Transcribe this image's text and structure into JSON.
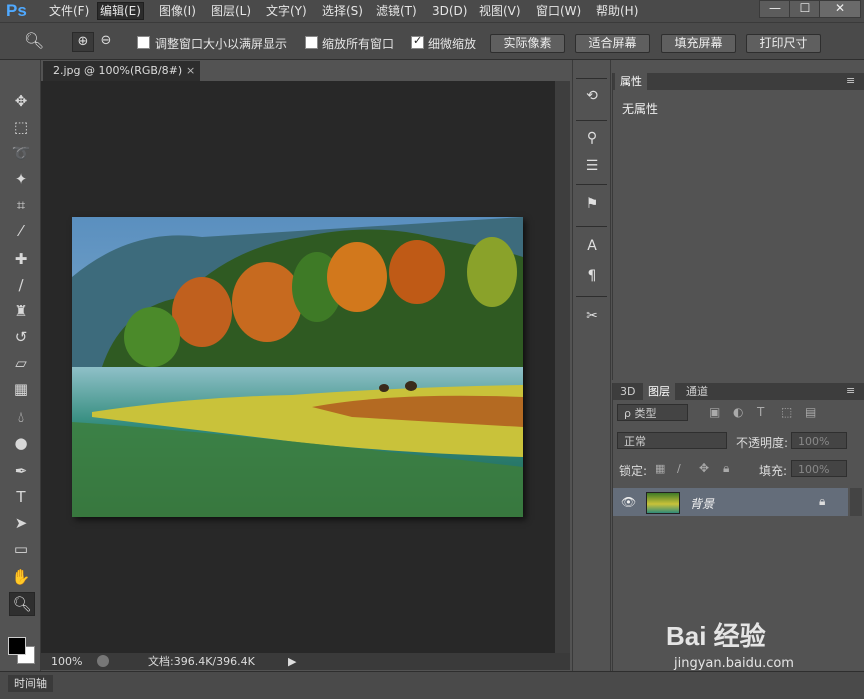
{
  "app": {
    "logo": "Ps"
  },
  "menu": [
    "文件(F)",
    "编辑(E)",
    "图像(I)",
    "图层(L)",
    "文字(Y)",
    "选择(S)",
    "滤镜(T)",
    "3D(D)",
    "视图(V)",
    "窗口(W)",
    "帮助(H)"
  ],
  "active_menu": "编辑(E)",
  "window_controls": {
    "minimize": "—",
    "maximize": "☐",
    "close": "✕"
  },
  "options": {
    "resize_windows": "调整窗口大小以满屏显示",
    "zoom_all": "缩放所有窗口",
    "scrubby_zoom": "细微缩放",
    "actual_pixels": "实际像素",
    "fit_screen": "适合屏幕",
    "fill_screen": "填充屏幕",
    "print_size": "打印尺寸",
    "scrubby_checked": true
  },
  "document": {
    "tab_title": "2.jpg @ 100%(RGB/8#)",
    "tab_close": "×",
    "zoom": "100%",
    "doc_size": "文档:396.4K/396.4K"
  },
  "panels": {
    "properties_tab": "属性",
    "properties_empty": "无属性",
    "layer_tabs": [
      "3D",
      "图层",
      "通道"
    ],
    "kind_filter": "ρ 类型",
    "blend_mode": "正常",
    "opacity_label": "不透明度:",
    "opacity_value": "100%",
    "lock_label": "锁定:",
    "fill_label": "填充:",
    "fill_value": "100%",
    "layer_name": "背景"
  },
  "timeline": {
    "label": "时间轴"
  },
  "watermark": {
    "brand": "Bai 经验",
    "url": "jingyan.baidu.com"
  },
  "colors": {
    "panel": "#535353",
    "dark": "#282828",
    "selected_layer": "#646d7a",
    "accent": "#4fa9ff"
  }
}
